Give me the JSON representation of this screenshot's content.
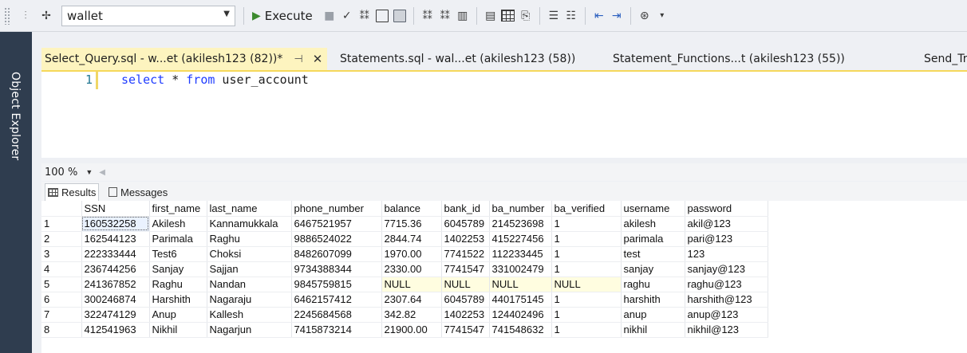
{
  "toolbar": {
    "database": "wallet",
    "execute_label": "Execute"
  },
  "object_explorer": {
    "label": "Object Explorer"
  },
  "doc_tabs": [
    {
      "label": "Select_Query.sql - w...et (akilesh123 (82))*",
      "active": true
    },
    {
      "label": "Statements.sql - wal...et (akilesh123 (58))",
      "active": false
    },
    {
      "label": "Statement_Functions...t (akilesh123 (55))",
      "active": false
    },
    {
      "label": "Send_Tra",
      "active": false
    }
  ],
  "editor": {
    "line_number": "1",
    "code_keyword1": "select",
    "code_mid": " * ",
    "code_keyword2": "from",
    "code_rest": " user_account"
  },
  "zoom": {
    "value": "100 %"
  },
  "results_tabs": {
    "results": "Results",
    "messages": "Messages"
  },
  "grid": {
    "columns": [
      "SSN",
      "first_name",
      "last_name",
      "phone_number",
      "balance",
      "bank_id",
      "ba_number",
      "ba_verified",
      "username",
      "password"
    ],
    "rows": [
      [
        "1",
        "160532258",
        "Akilesh",
        "Kannamukkala",
        "6467521957",
        "7715.36",
        "6045789",
        "214523698",
        "1",
        "akilesh",
        "akil@123"
      ],
      [
        "2",
        "162544123",
        "Parimala",
        "Raghu",
        "9886524022",
        "2844.74",
        "1402253",
        "415227456",
        "1",
        "parimala",
        "pari@123"
      ],
      [
        "3",
        "222333444",
        "Test6",
        "Choksi",
        "8482607099",
        "1970.00",
        "7741522",
        "112233445",
        "1",
        "test",
        "123"
      ],
      [
        "4",
        "236744256",
        "Sanjay",
        "Sajjan",
        "9734388344",
        "2330.00",
        "7741547",
        "331002479",
        "1",
        "sanjay",
        "sanjay@123"
      ],
      [
        "5",
        "241367852",
        "Raghu",
        "Nandan",
        "9845759815",
        "NULL",
        "NULL",
        "NULL",
        "NULL",
        "raghu",
        "raghu@123"
      ],
      [
        "6",
        "300246874",
        "Harshith",
        "Nagaraju",
        "6462157412",
        "2307.64",
        "6045789",
        "440175145",
        "1",
        "harshith",
        "harshith@123"
      ],
      [
        "7",
        "322474129",
        "Anup",
        "Kallesh",
        "2245684568",
        "342.82",
        "1402253",
        "124402496",
        "1",
        "anup",
        "anup@123"
      ],
      [
        "8",
        "412541963",
        "Nikhil",
        "Nagarjun",
        "7415873214",
        "21900.00",
        "7741547",
        "741548632",
        "1",
        "nikhil",
        "nikhil@123"
      ]
    ]
  }
}
